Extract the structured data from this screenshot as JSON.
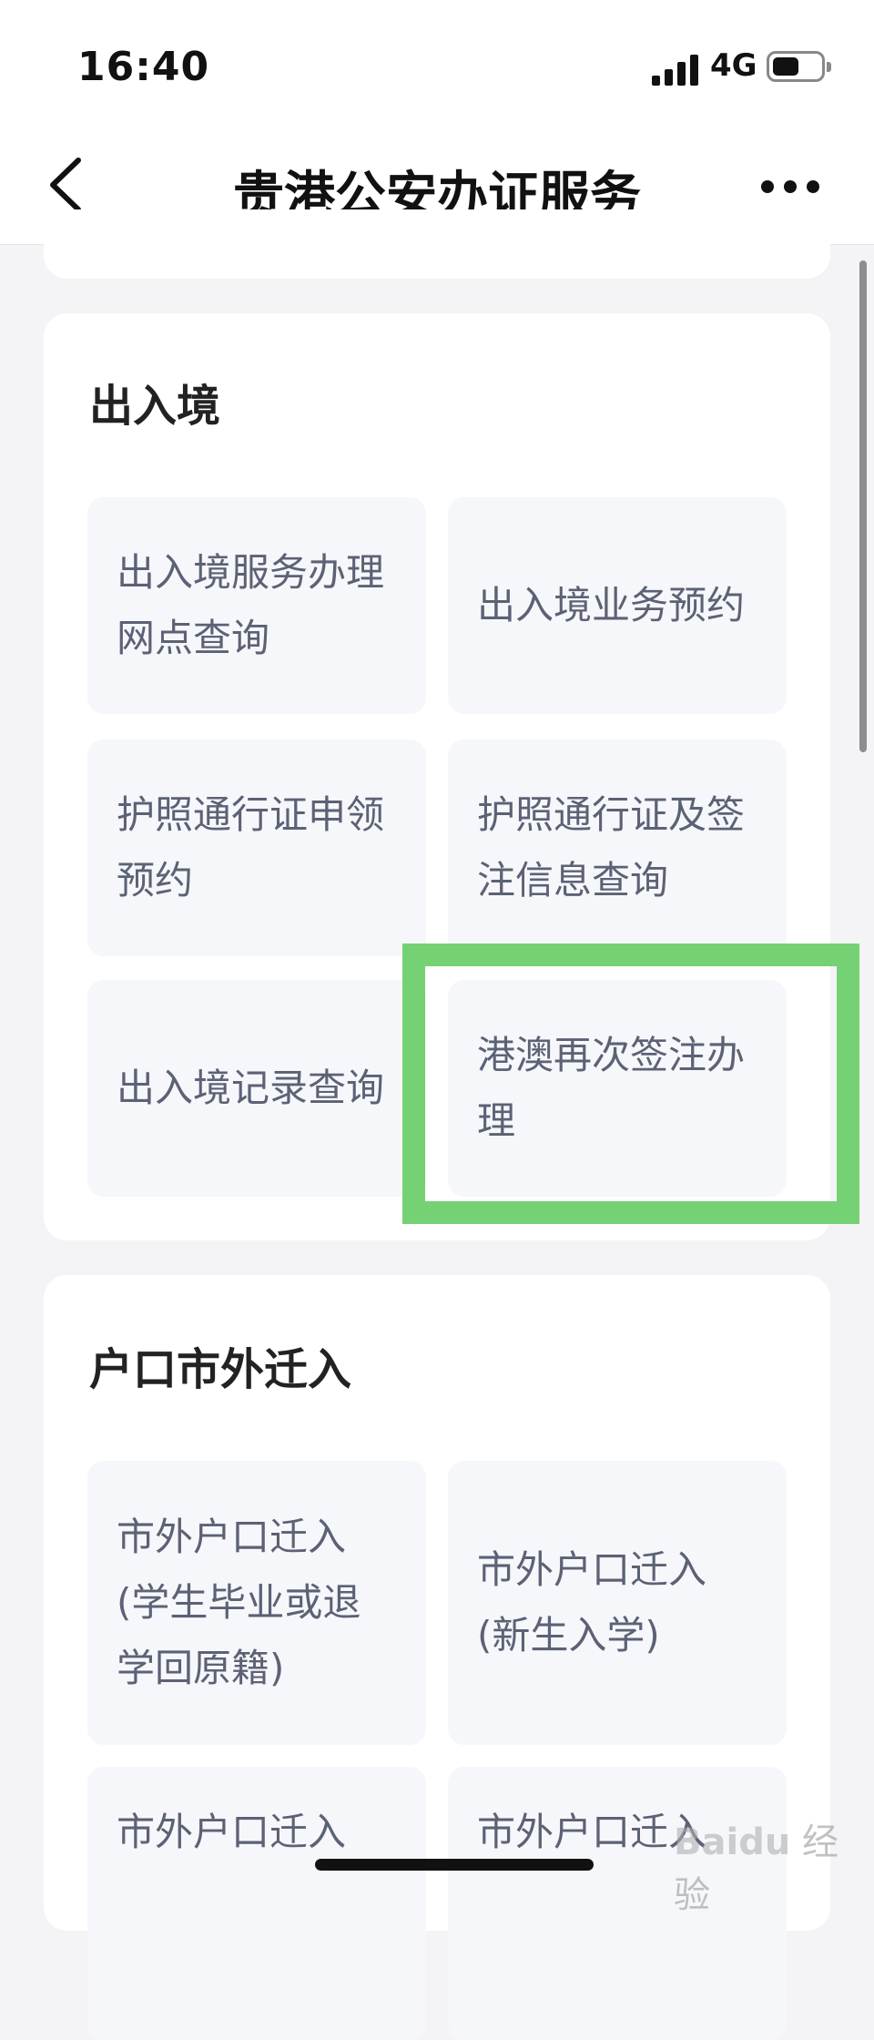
{
  "status_bar": {
    "time": "16:40",
    "network": "4G"
  },
  "nav": {
    "title": "贵港公安办证服务"
  },
  "sections": [
    {
      "title": "出入境",
      "tiles": [
        "出入境服务办理网点查询",
        "出入境业务预约",
        "护照通行证申领预约",
        "护照通行证及签注信息查询",
        "出入境记录查询",
        "港澳再次签注办理"
      ]
    },
    {
      "title": "户口市外迁入",
      "tiles": [
        "市外户口迁入(学生毕业或退学回原籍)",
        "市外户口迁入(新生入学)",
        "市外户口迁入",
        "市外户口迁入"
      ]
    }
  ],
  "watermark": {
    "brand": "Baidu",
    "text": "经验"
  },
  "colors": {
    "highlight": "#74d274",
    "tile_text": "#5c6275",
    "tile_bg": "#f6f7fa"
  }
}
